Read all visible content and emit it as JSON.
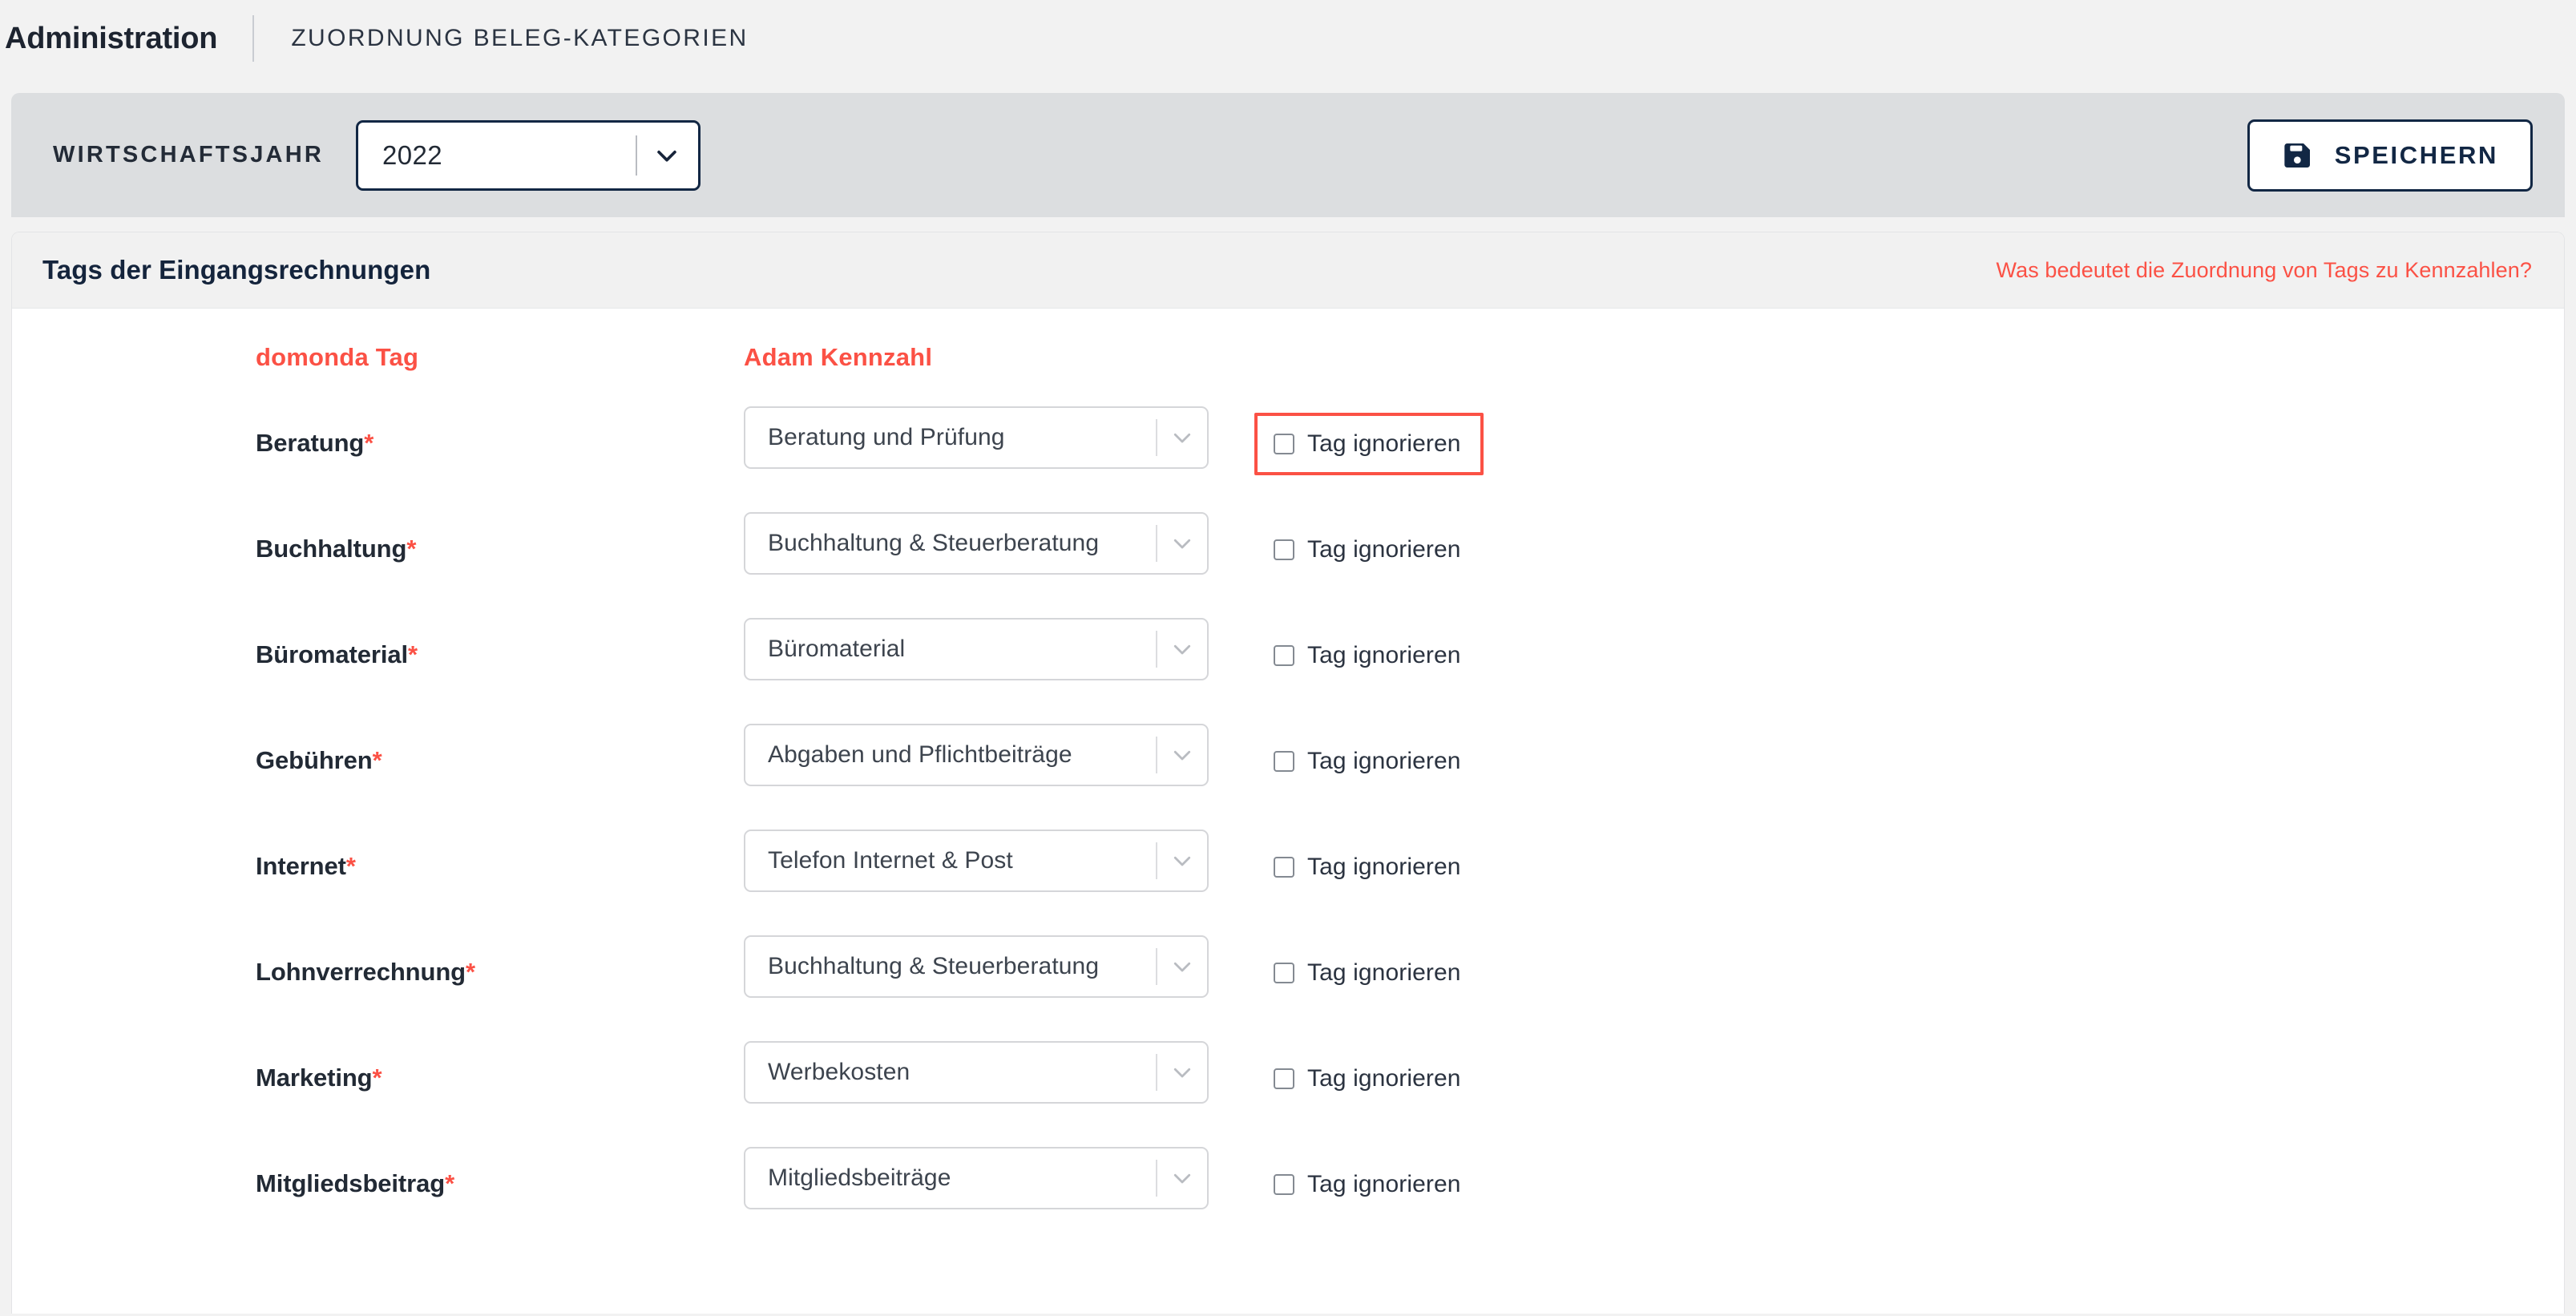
{
  "topbar": {
    "app_title": "Administration",
    "section_title": "ZUORDNUNG BELEG-KATEGORIEN"
  },
  "toolbar": {
    "year_label": "WIRTSCHAFTSJAHR",
    "year_value": "2022",
    "save_label": "SPEICHERN",
    "save_icon": "floppy-disk-icon",
    "caret_icon": "chevron-down-icon"
  },
  "card": {
    "title": "Tags der Eingangsrechnungen",
    "help_link": "Was bedeutet die Zuordnung von Tags zu Kennzahlen?"
  },
  "table": {
    "headers": {
      "tag": "domonda Tag",
      "kennzahl": "Adam Kennzahl"
    },
    "ignore_label": "Tag ignorieren",
    "required_marker": "*",
    "rows": [
      {
        "tag": "Beratung",
        "required": true,
        "kennzahl": "Beratung und Prüfung",
        "ignored": false,
        "highlighted": true
      },
      {
        "tag": "Buchhaltung",
        "required": true,
        "kennzahl": "Buchhaltung & Steuerberatung",
        "ignored": false,
        "highlighted": false
      },
      {
        "tag": "Büromaterial",
        "required": true,
        "kennzahl": "Büromaterial",
        "ignored": false,
        "highlighted": false
      },
      {
        "tag": "Gebühren",
        "required": true,
        "kennzahl": "Abgaben und Pflichtbeiträge",
        "ignored": false,
        "highlighted": false
      },
      {
        "tag": "Internet",
        "required": true,
        "kennzahl": "Telefon Internet & Post",
        "ignored": false,
        "highlighted": false
      },
      {
        "tag": "Lohnverrechnung",
        "required": true,
        "kennzahl": "Buchhaltung & Steuerberatung",
        "ignored": false,
        "highlighted": false
      },
      {
        "tag": "Marketing",
        "required": true,
        "kennzahl": "Werbekosten",
        "ignored": false,
        "highlighted": false
      },
      {
        "tag": "Mitgliedsbeitrag",
        "required": true,
        "kennzahl": "Mitgliedsbeiträge",
        "ignored": false,
        "highlighted": false
      }
    ]
  },
  "colors": {
    "accent_red": "#fb5145",
    "navy": "#122744",
    "page_bg": "#f2f2f2",
    "toolbar_bg": "#dcdee0",
    "card_head_bg": "#f1f1f1"
  }
}
